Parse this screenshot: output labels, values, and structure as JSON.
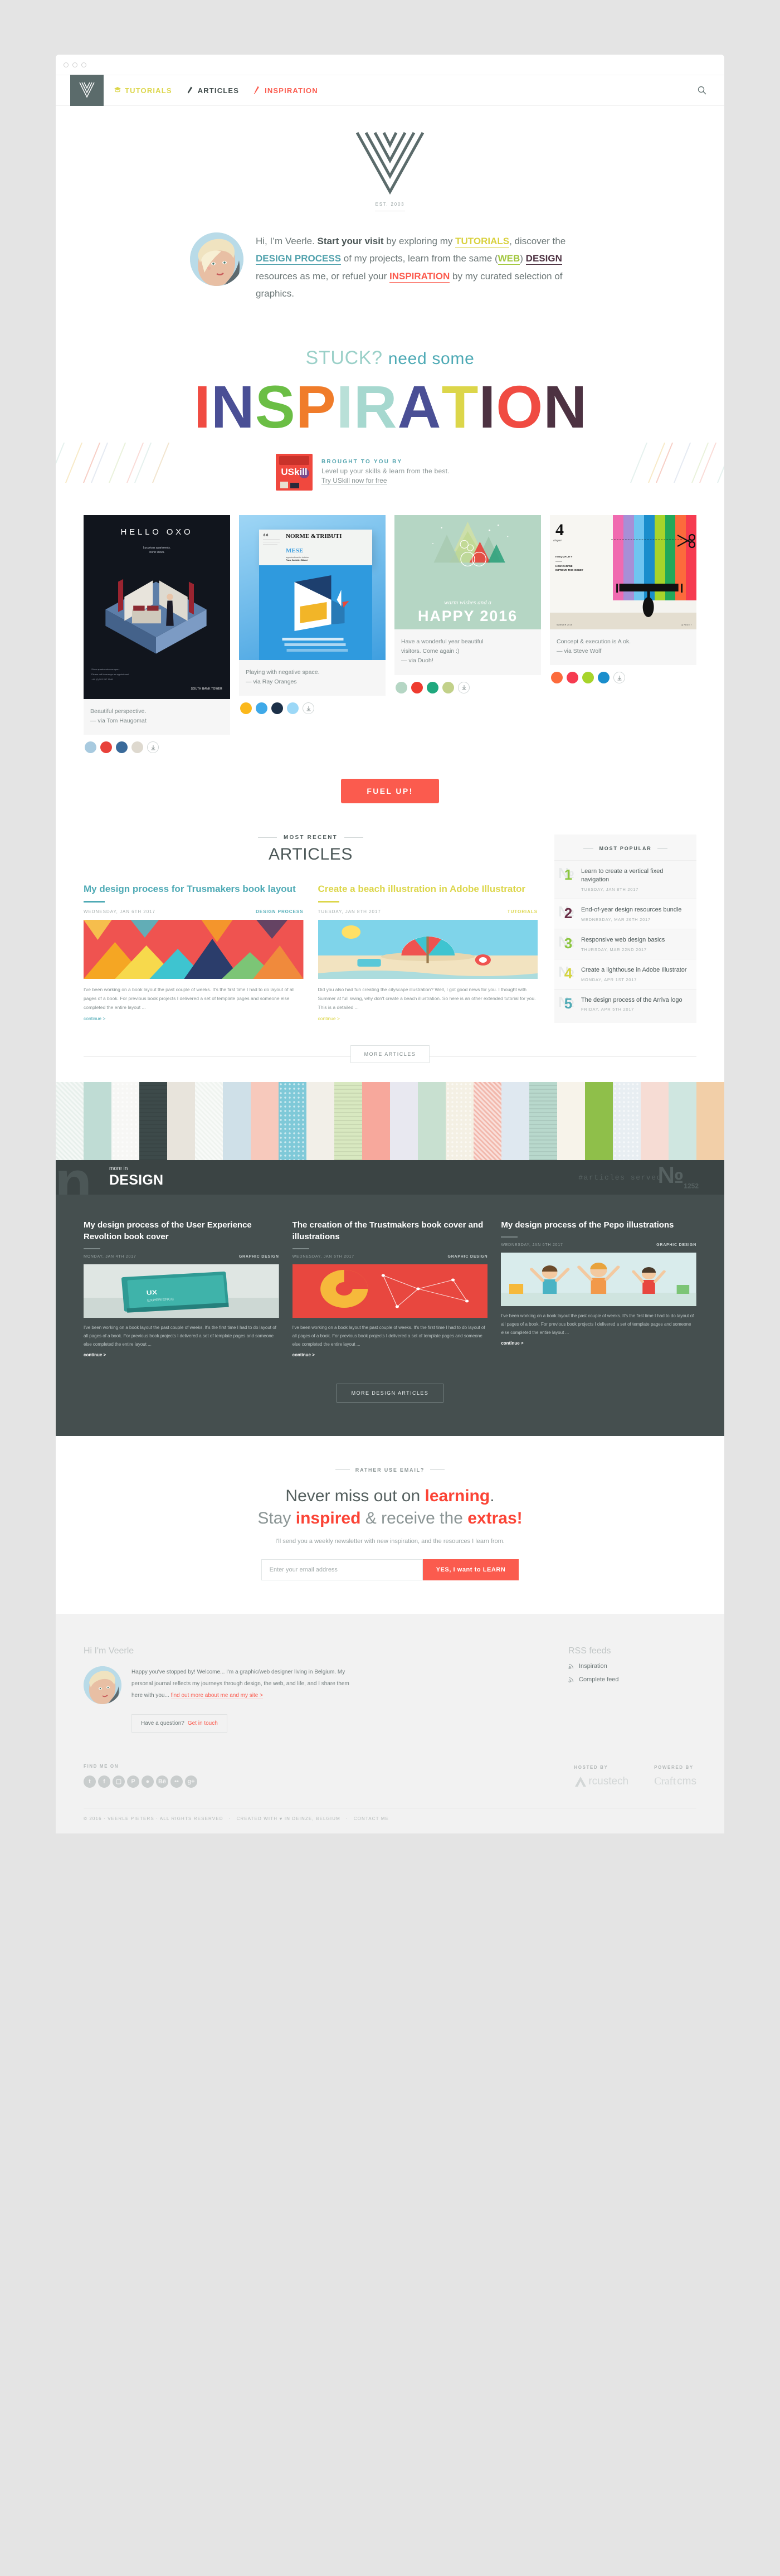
{
  "nav": {
    "logo_alt": "veerle-v-logo",
    "links": [
      {
        "label": "TUTORIALS",
        "color": "#dcd64a",
        "icon": "graduation-cap-icon"
      },
      {
        "label": "ARTICLES",
        "color": "#3f4a4a",
        "icon": "pen-icon"
      },
      {
        "label": "INSPIRATION",
        "color": "#fb5b4e",
        "icon": "brush-icon"
      }
    ],
    "search_label": "search-icon"
  },
  "hero": {
    "est": "EST. 2003"
  },
  "intro": {
    "line1_a": "Hi, I’m Veerle. ",
    "line1_b": "Start your visit",
    "line1_c": " by exploring my",
    "tutorials": "TUTORIALS",
    "after_tut": ", discover the ",
    "design_process": "DESIGN PROCESS",
    "after_dp": " of my",
    "line3_a": "projects, learn from the same (",
    "web": "WEB",
    "line3_b": ") ",
    "design": "DESIGN",
    "line4_a": "resources as me, or refuel your ",
    "inspiration": "INSPIRATION",
    "line4_b": " by my",
    "line5": "curated selection of graphics."
  },
  "inspiration_band": {
    "stuck": "STUCK?",
    "need_some": "need some",
    "word": "INSPIRATION",
    "letters": [
      {
        "ch": "I",
        "color": "#f04b42"
      },
      {
        "ch": "N",
        "color": "#4a4f95"
      },
      {
        "ch": "S",
        "color": "#6bbe45"
      },
      {
        "ch": "P",
        "color": "#f07c2a"
      },
      {
        "ch": "I",
        "color": "#b9e0d8"
      },
      {
        "ch": "R",
        "color": "#a6d8cf"
      },
      {
        "ch": "A",
        "color": "#4a4f95"
      },
      {
        "ch": "T",
        "color": "#dcd64a"
      },
      {
        "ch": "I",
        "color": "#4d3242"
      },
      {
        "ch": "O",
        "color": "#f04b42"
      },
      {
        "ch": "N",
        "color": "#4d3242"
      }
    ]
  },
  "sponsor": {
    "brand": "USkill",
    "kicker": "BROUGHT TO YOU BY",
    "line": "Level up your skills & learn from the best.",
    "link": "Try USkill now for free"
  },
  "inspiration_cards": [
    {
      "thumb_kind": "hello-oxo-poster",
      "thumb_title": "HELLO OXO",
      "thumb_sub1": "Luxurious apartments.",
      "thumb_sub2": "Iconic views.",
      "thumb_brand": "SOUTH BANK TOWER",
      "caption1": "Beautiful perspective.",
      "caption2": "— via Tom Haugomat",
      "swatches": [
        "#a8cadf",
        "#e8413a",
        "#3a6a9a",
        "#ded9cf"
      ]
    },
    {
      "thumb_kind": "norme-tributi-poster",
      "thumb_title": "NORME &TRIBUTI",
      "thumb_sub1": "MESE",
      "caption1": "Playing with negative space.",
      "caption2": "— via Ray Oranges",
      "swatches": [
        "#fbb81c",
        "#3fa9e8",
        "#1c3048",
        "#9cd8f7"
      ]
    },
    {
      "thumb_kind": "happy-2016-card",
      "thumb_script": "warm wishes and a",
      "thumb_title": "HAPPY 2016",
      "caption1": "Have a wonderful year beautiful",
      "caption2": "visitors. Come again :)",
      "caption3": "— via Duoh!",
      "swatches": [
        "#b5d6c4",
        "#ee3b2f",
        "#1fa87e",
        "#c2d18a"
      ]
    },
    {
      "thumb_kind": "chapter-4-roller",
      "thumb_title": "4",
      "thumb_chapter": "chapter",
      "thumb_sub1": "INEQUALITY",
      "thumb_sub2": "HOW CAN WE IMPROVE THIS ISSUE?",
      "caption1": "Concept & execution is A ok.",
      "caption2": "— via Steve Wolf",
      "swatches": [
        "#fc6b3c",
        "#f63b50",
        "#a7d42b",
        "#1a8ecc"
      ]
    }
  ],
  "fuel_button": "FUEL UP!",
  "articles_section": {
    "kicker": "MOST RECENT",
    "title": "ARTICLES",
    "items": [
      {
        "title": "My design process for Trusmakers book layout",
        "accent": "teal",
        "date": "WEDNESDAY, JAN 6TH 2017",
        "category": "DESIGN PROCESS",
        "thumb_kind": "triangle-mosaic",
        "body": "I've been working on a book layout the past couple of weeks. It's the first time I had to do layout of all pages of a book. For previous book projects I delivered a set of template pages and someone else completed the entire layout ...",
        "continue": "continue >"
      },
      {
        "title": "Create a beach illustration in Adobe Illustrator",
        "accent": "yellow",
        "date": "TUESDAY, JAN 8TH 2017",
        "category": "TUTORIALS",
        "thumb_kind": "beach-umbrella",
        "body": "Did you also had fun creating the cityscape illustration? Well, I got good news for you. I thought with Summer at full swing, why don't create a beach illustration. So here is an other extended tutorial for you. This is a detailed ...",
        "continue": "continue >"
      }
    ],
    "more_button": "MORE ARTICLES"
  },
  "popular": {
    "kicker": "MOST POPULAR",
    "items": [
      {
        "num": "1",
        "color": "#8cc63f",
        "title": "Learn to create a vertical fixed navigation",
        "date": "TUESDAY, JAN 8TH 2017"
      },
      {
        "num": "2",
        "color": "#6b3048",
        "title": "End-of-year design resources bundle",
        "date": "WEDNESDAY, MAR 26TH 2017"
      },
      {
        "num": "3",
        "color": "#8cc63f",
        "title": "Responsive web design basics",
        "date": "THURSDAY, MAR 22ND 2017"
      },
      {
        "num": "4",
        "color": "#d4d43c",
        "title": "Create a lighthouse in Adobe Illustrator",
        "date": "MONDAY, APR 1ST 2017"
      },
      {
        "num": "5",
        "color": "#4eaab5",
        "title": "The design process of the Arriva logo",
        "date": "FRIDAY, APR 5TH 2017"
      }
    ]
  },
  "design_section": {
    "more_in": "more in",
    "title": "DESIGN",
    "served_label": "#articles served",
    "served_no": "№",
    "served_count": "1252",
    "items": [
      {
        "title": "My design process of the User Experience Revoltion book cover",
        "date": "MONDAY, JAN 4TH 2017",
        "category": "GRAPHIC DESIGN",
        "thumb_kind": "book-cover-teal",
        "body": "I've been working on a book layout the past couple of weeks. It's the first time I had to do layout of all pages of a book. For previous book projects I delivered a set of template pages and someone else completed the entire layout ...",
        "continue": "continue >"
      },
      {
        "title": "The creation of the Trustmakers book cover and illustrations",
        "date": "WEDNESDAY, JAN 6TH 2017",
        "category": "GRAPHIC DESIGN",
        "thumb_kind": "red-geometric",
        "body": "I've been working on a book layout the past couple of weeks. It's the first time I had to do layout of all pages of a book. For previous book projects I delivered a set of template pages and someone else completed the entire layout ...",
        "continue": "continue >"
      },
      {
        "title": "My design process of the Pepo illustrations",
        "date": "WEDNESDAY, JAN 6TH 2017",
        "category": "GRAPHIC DESIGN",
        "thumb_kind": "kids-illustration",
        "body": "I've been working on a book layout the past couple of weeks. It's the first time I had to do layout of all pages of a book. For previous book projects I delivered a set of template pages and someone else completed the entire layout ...",
        "continue": "continue >"
      }
    ],
    "more_button": "MORE DESIGN ARTICLES"
  },
  "newsletter": {
    "kicker": "RATHER USE EMAIL?",
    "h1_a": "Never miss out on ",
    "h1_b": "learning",
    "h1_c": ".",
    "h2_a": "Stay ",
    "h2_b": "inspired",
    "h2_c": " & receive the ",
    "h2_d": "extras",
    "h2_e": "!",
    "sub": "I'll send you a weekly newsletter with new inspiration, and the resources I learn from.",
    "placeholder": "Enter your email address",
    "button": "YES, I want to LEARN"
  },
  "footer": {
    "title": "Hi I'm Veerle",
    "body_a": "Happy you've stopped by! Welcome... I'm a graphic/web designer living in Belgium. My personal journal reflects my journeys through design, the web, and life, and I share them here with you... ",
    "body_link": "find out more about me and my site  >",
    "question": "Have a question?",
    "question_link": "Get in touch",
    "rss_title": "RSS feeds",
    "rss_items": [
      "Inspiration",
      "Complete feed"
    ],
    "find_me_on": "FIND ME ON",
    "socials": [
      "twitter-icon",
      "facebook-icon",
      "instagram-icon",
      "pinterest-icon",
      "dribbble-icon",
      "behance-icon",
      "flickr-icon",
      "googleplus-icon"
    ],
    "hosted_by": "HOSTED BY",
    "host_name_a": "A",
    "host_name_b": "rcustech",
    "powered_by": "POWERED BY",
    "power_name_a": "Craft",
    "power_name_b": "cms",
    "copyright": "© 2016 · VEERLE PIETERS · ALL RIGHTS RESERVED",
    "created_with": "CREATED WITH ♥ IN DEINZE, BELGIUM",
    "contact": "CONTACT ME"
  }
}
